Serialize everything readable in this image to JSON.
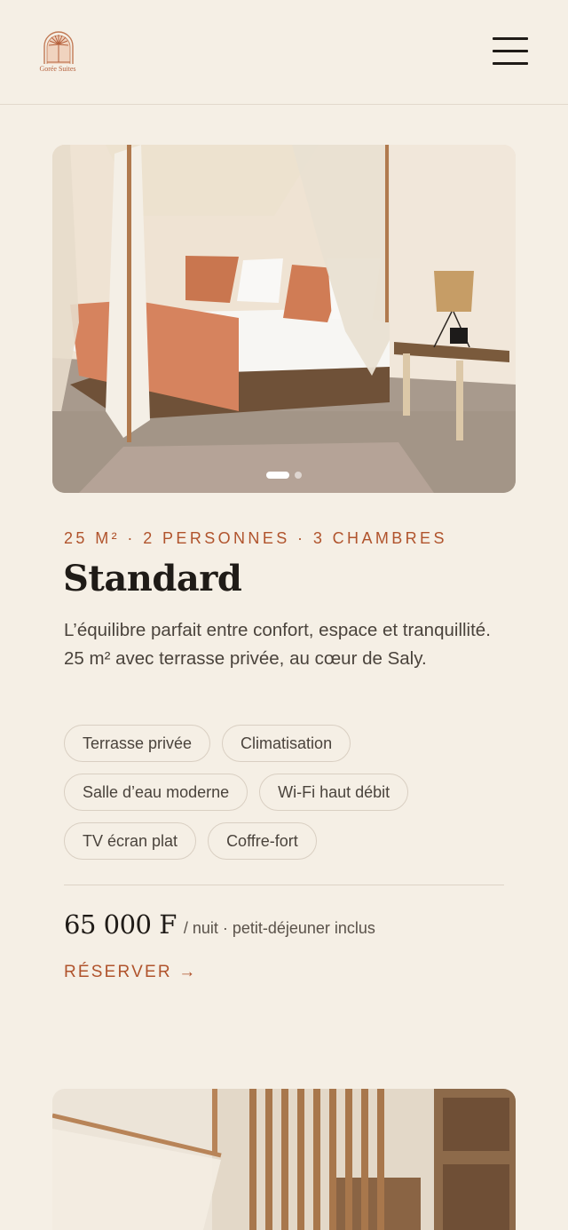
{
  "header": {
    "brand": "Gorée Suites",
    "menu_icon": "hamburger-menu-icon",
    "logo_icon": "palm-arch-logo-icon"
  },
  "room": {
    "gallery": {
      "slide_count": 2,
      "active_slide": 1
    },
    "meta": "25 M² · 2 PERSONNES · 3 CHAMBRES",
    "title": "Standard",
    "description": "L’équilibre parfait entre confort, espace et tranquillité. 25 m² avec terrasse privée, au cœur de Saly.",
    "amenities": [
      "Terrasse privée",
      "Climatisation",
      "Salle d’eau moderne",
      "Wi-Fi haut débit",
      "TV écran plat",
      "Coffre-fort"
    ],
    "price": "65 000 F",
    "price_note": "/ nuit · petit-déjeuner inclus",
    "cta": "RÉSERVER →"
  },
  "colors": {
    "background": "#f5efe5",
    "accent": "#b0532c",
    "text": "#1f1b17"
  }
}
